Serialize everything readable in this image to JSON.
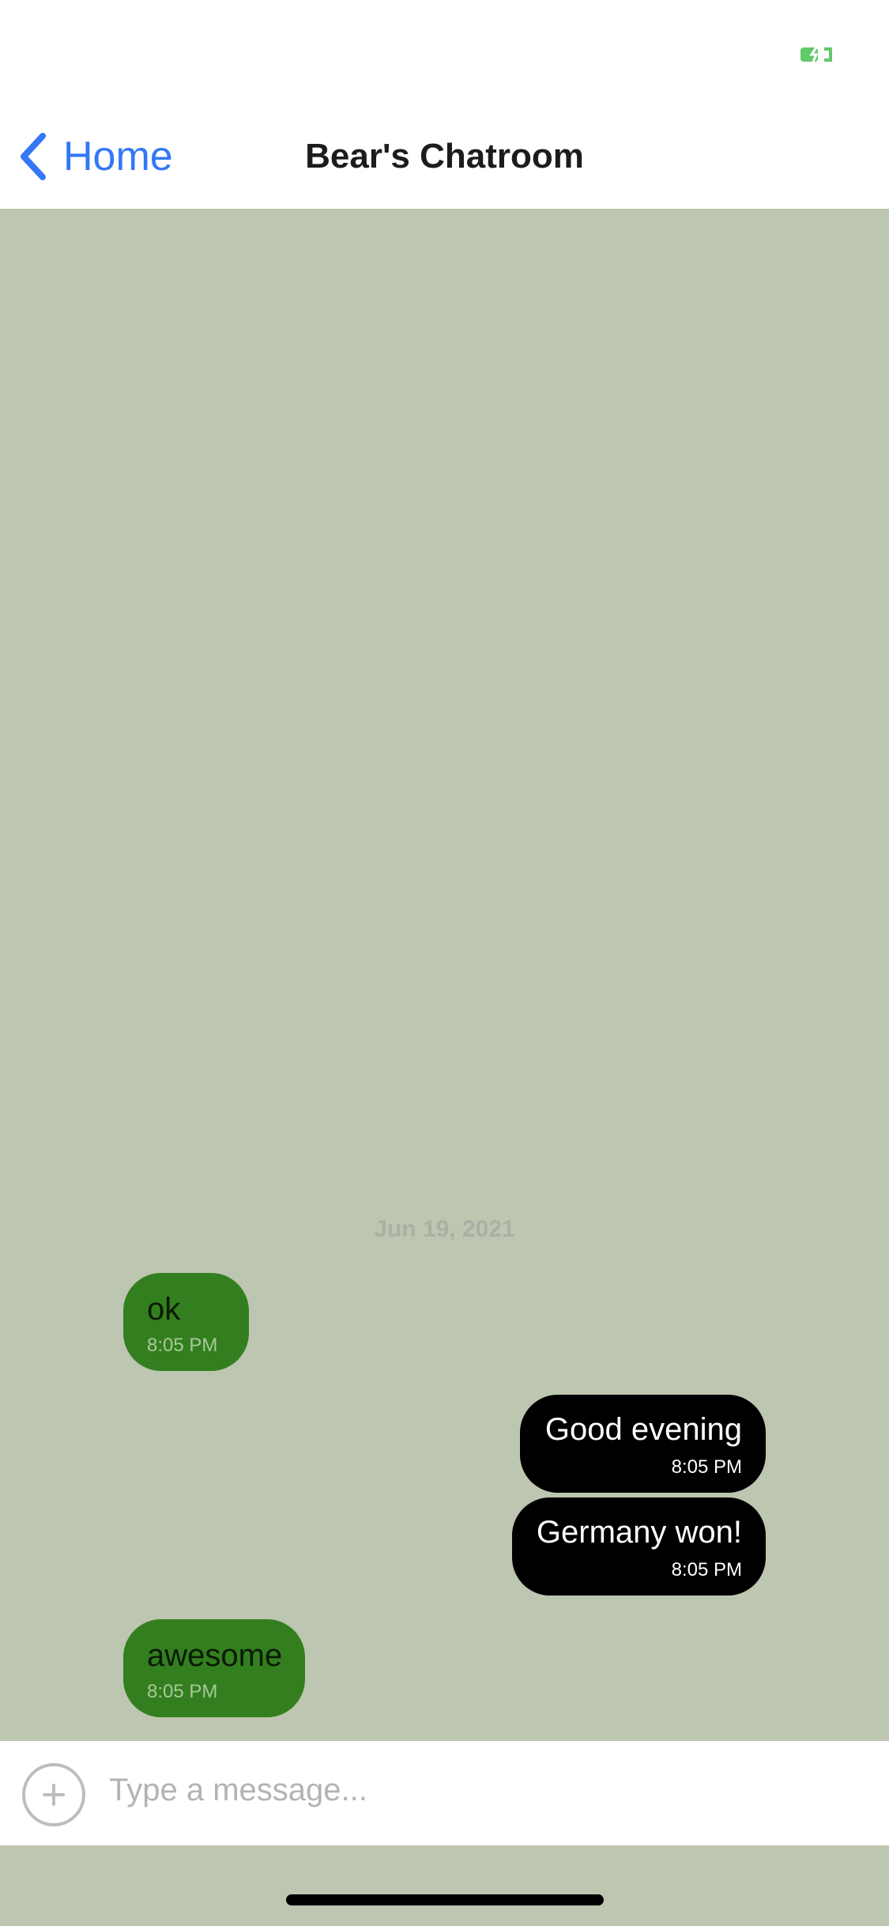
{
  "status_bar": {
    "battery_icon": "battery-charging-icon",
    "battery_color": "#62C96A"
  },
  "nav": {
    "back_icon": "chevron-left-icon",
    "back_label": "Home",
    "title": "Bear's Chatroom",
    "accent_color": "#3478F6"
  },
  "chat": {
    "background_color": "#BDC6B0",
    "date_divider": "Jun 19, 2021",
    "messages": [
      {
        "direction": "incoming",
        "text": "ok",
        "time": "8:05 PM"
      },
      {
        "direction": "outgoing",
        "text": "Good evening",
        "time": "8:05 PM"
      },
      {
        "direction": "outgoing",
        "text": "Germany won!",
        "time": "8:05 PM"
      },
      {
        "direction": "incoming",
        "text": "awesome",
        "time": "8:05 PM"
      }
    ],
    "incoming_bubble_color": "#337F1F",
    "outgoing_bubble_color": "#000000"
  },
  "composer": {
    "add_icon": "plus-circle-icon",
    "placeholder": "Type a message...",
    "value": ""
  }
}
